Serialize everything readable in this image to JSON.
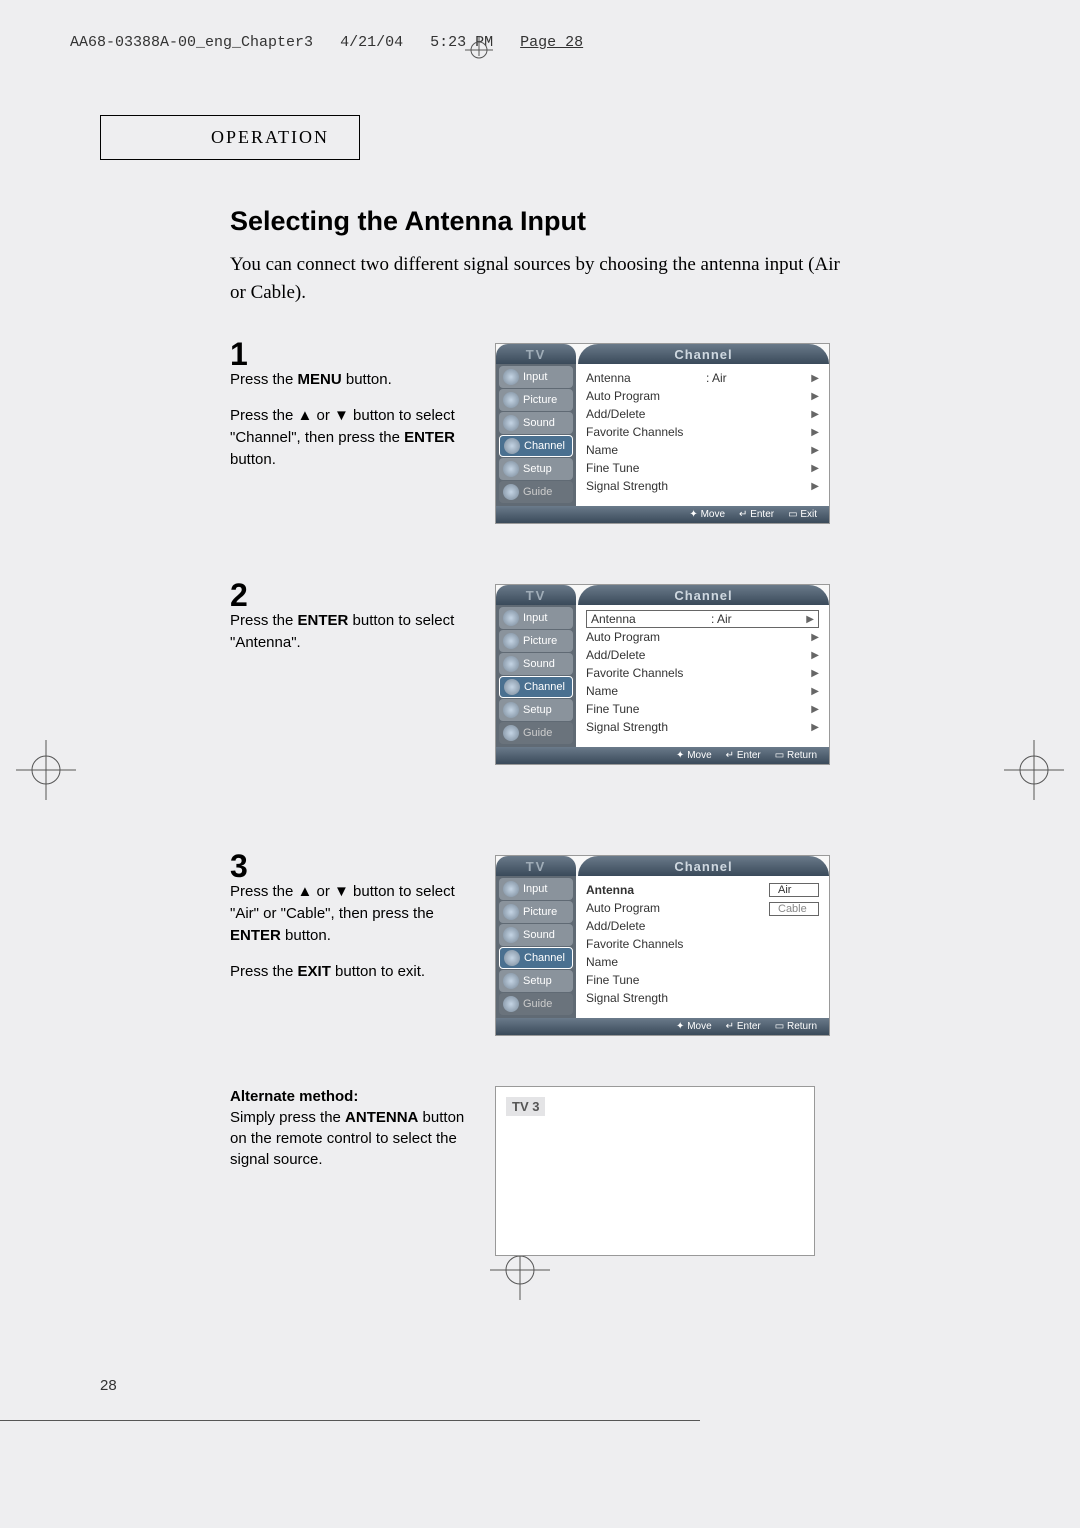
{
  "header": {
    "file": "AA68-03388A-00_eng_Chapter3",
    "date": "4/21/04",
    "time": "5:23 PM",
    "page": "Page 28"
  },
  "section_tab": "OPERATION",
  "title": "Selecting the Antenna Input",
  "intro": "You can connect two different signal sources by choosing the antenna input (Air or Cable).",
  "steps": [
    {
      "num": "1",
      "para1_a": "Press the ",
      "para1_b": "MENU",
      "para1_c": " button.",
      "para2_a": "Press the ▲ or ▼ button to select \"Channel\", then press the ",
      "para2_b": "ENTER",
      "para2_c": " button."
    },
    {
      "num": "2",
      "para1_a": "Press the ",
      "para1_b": "ENTER",
      "para1_c": " button to select \"Antenna\"."
    },
    {
      "num": "3",
      "para1_a": "Press the ▲ or ▼ button to select \"Air\" or \"Cable\", then press the ",
      "para1_b": "ENTER",
      "para1_c": " button.",
      "para2_a": "Press the ",
      "para2_b": "EXIT",
      "para2_c": " button to exit."
    }
  ],
  "alternate": {
    "heading": "Alternate method:",
    "text_a": "Simply press the ",
    "text_b": "ANTENNA",
    "text_c": " button on the remote control to select the signal source."
  },
  "osd": {
    "tv": "TV",
    "channel": "Channel",
    "sidebar": [
      "Input",
      "Picture",
      "Sound",
      "Channel",
      "Setup",
      "Guide"
    ],
    "rows": [
      "Antenna",
      "Auto Program",
      "Add/Delete",
      "Favorite Channels",
      "Name",
      "Fine Tune",
      "Signal Strength"
    ],
    "antenna_val": ":  Air",
    "options": [
      "Air",
      "Cable"
    ],
    "footer": {
      "move": "Move",
      "enter": "Enter",
      "exit": "Exit",
      "return": "Return"
    }
  },
  "tvbox": "TV 3",
  "page_num": "28"
}
